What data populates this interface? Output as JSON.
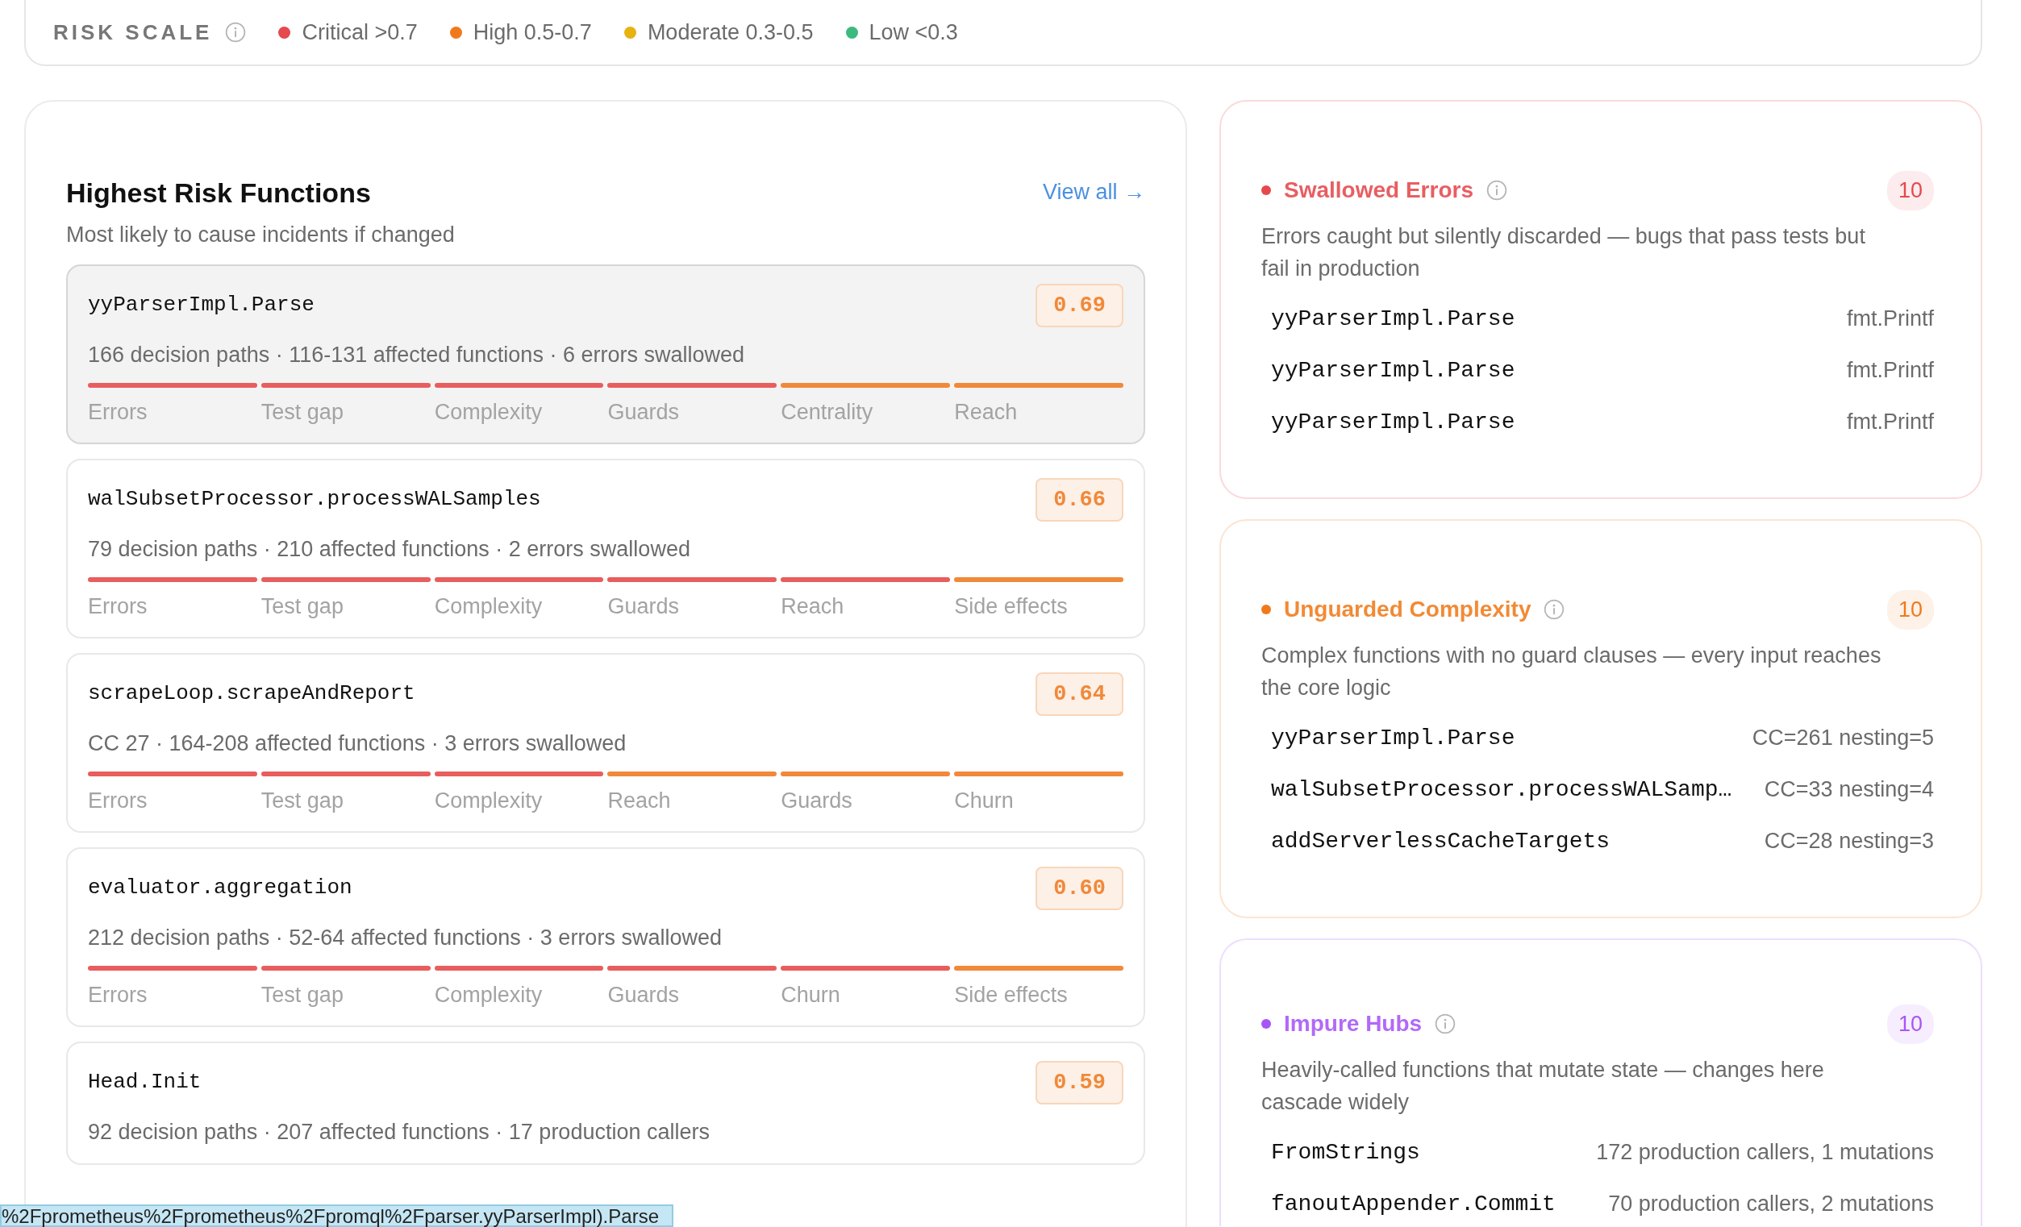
{
  "risk_scale": {
    "label": "RISK SCALE",
    "levels": [
      {
        "label": "Critical >0.7",
        "color": "#e5484d"
      },
      {
        "label": "High 0.5-0.7",
        "color": "#f07a1a"
      },
      {
        "label": "Moderate 0.3-0.5",
        "color": "#e8b20f"
      },
      {
        "label": "Low <0.3",
        "color": "#3dba7e"
      }
    ]
  },
  "highest_risk": {
    "title": "Highest Risk Functions",
    "subtitle": "Most likely to cause incidents if changed",
    "link": "View all →",
    "items": [
      {
        "name": "yyParserImpl.Parse",
        "score": "0.69",
        "stats": "166 decision paths · 116-131 affected functions · 6 errors swallowed",
        "selected": true,
        "factors": [
          {
            "label": "Errors",
            "color": "#e85d5d"
          },
          {
            "label": "Test gap",
            "color": "#e85d5d"
          },
          {
            "label": "Complexity",
            "color": "#e85d5d"
          },
          {
            "label": "Guards",
            "color": "#e85d5d"
          },
          {
            "label": "Centrality",
            "color": "#f0893a"
          },
          {
            "label": "Reach",
            "color": "#f0893a"
          }
        ]
      },
      {
        "name": "walSubsetProcessor.processWALSamples",
        "score": "0.66",
        "stats": "79 decision paths · 210 affected functions · 2 errors swallowed",
        "selected": false,
        "factors": [
          {
            "label": "Errors",
            "color": "#e85d5d"
          },
          {
            "label": "Test gap",
            "color": "#e85d5d"
          },
          {
            "label": "Complexity",
            "color": "#e85d5d"
          },
          {
            "label": "Guards",
            "color": "#e85d5d"
          },
          {
            "label": "Reach",
            "color": "#e85d5d"
          },
          {
            "label": "Side effects",
            "color": "#f0893a"
          }
        ]
      },
      {
        "name": "scrapeLoop.scrapeAndReport",
        "score": "0.64",
        "stats": "CC 27 · 164-208 affected functions · 3 errors swallowed",
        "selected": false,
        "factors": [
          {
            "label": "Errors",
            "color": "#e85d5d"
          },
          {
            "label": "Test gap",
            "color": "#e85d5d"
          },
          {
            "label": "Complexity",
            "color": "#e85d5d"
          },
          {
            "label": "Reach",
            "color": "#f0893a"
          },
          {
            "label": "Guards",
            "color": "#f0893a"
          },
          {
            "label": "Churn",
            "color": "#f0893a"
          }
        ]
      },
      {
        "name": "evaluator.aggregation",
        "score": "0.60",
        "stats": "212 decision paths · 52-64 affected functions · 3 errors swallowed",
        "selected": false,
        "factors": [
          {
            "label": "Errors",
            "color": "#e85d5d"
          },
          {
            "label": "Test gap",
            "color": "#e85d5d"
          },
          {
            "label": "Complexity",
            "color": "#e85d5d"
          },
          {
            "label": "Guards",
            "color": "#e85d5d"
          },
          {
            "label": "Churn",
            "color": "#e85d5d"
          },
          {
            "label": "Side effects",
            "color": "#f0893a"
          }
        ]
      },
      {
        "name": "Head.Init",
        "score": "0.59",
        "stats": "92 decision paths · 207 affected functions · 17 production callers",
        "selected": false
      }
    ]
  },
  "categories": [
    {
      "title": "Swallowed Errors",
      "count": "10",
      "color": "#e5484d",
      "description": "Errors caught but silently discarded — bugs that pass tests but fail in production",
      "rows": [
        {
          "name": "yyParserImpl.Parse",
          "detail": "fmt.Printf"
        },
        {
          "name": "yyParserImpl.Parse",
          "detail": "fmt.Printf"
        },
        {
          "name": "yyParserImpl.Parse",
          "detail": "fmt.Printf"
        }
      ]
    },
    {
      "title": "Unguarded Complexity",
      "count": "10",
      "color": "#f07a1a",
      "description": "Complex functions with no guard clauses — every input reaches the core logic",
      "rows": [
        {
          "name": "yyParserImpl.Parse",
          "detail": "CC=261 nesting=5"
        },
        {
          "name": "walSubsetProcessor.processWALSamp…",
          "detail": "CC=33 nesting=4"
        },
        {
          "name": "addServerlessCacheTargets",
          "detail": "CC=28 nesting=3"
        }
      ]
    },
    {
      "title": "Impure Hubs",
      "count": "10",
      "color": "#a855f7",
      "description": "Heavily-called functions that mutate state — changes here cascade widely",
      "rows": [
        {
          "name": "FromStrings",
          "detail": "172 production callers, 1 mutations"
        },
        {
          "name": "fanoutAppender.Commit",
          "detail": "70 production callers, 2 mutations"
        }
      ]
    }
  ],
  "status_url": "%2Fprometheus%2Fprometheus%2Fpromql%2Fparser.yyParserImpl).Parse"
}
